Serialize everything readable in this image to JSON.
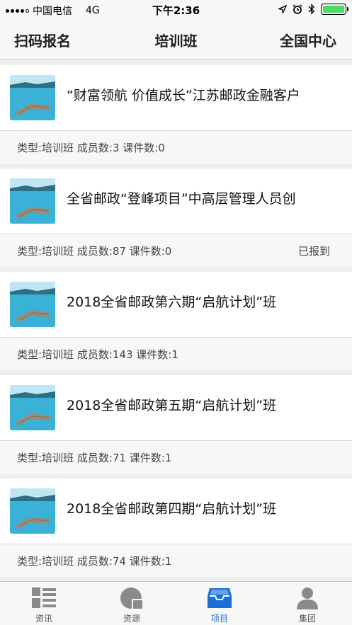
{
  "status_bar": {
    "carrier": "中国电信",
    "network": "4G",
    "time": "下午2:36"
  },
  "nav": {
    "left": "扫码报名",
    "title": "培训班",
    "right": "全国中心"
  },
  "projects": [
    {
      "title": "“财富领航 价值成长”江苏邮政金融客户",
      "meta": "类型:培训班 成员数:3 课件数:0",
      "status": ""
    },
    {
      "title": "全省邮政“登峰项目”中高层管理人员创",
      "meta": "类型:培训班 成员数:87 课件数:0",
      "status": "已报到"
    },
    {
      "title": "2018全省邮政第六期“启航计划”班",
      "meta": "类型:培训班 成员数:143 课件数:1",
      "status": ""
    },
    {
      "title": "2018全省邮政第五期“启航计划”班",
      "meta": "类型:培训班 成员数:71 课件数:1",
      "status": ""
    },
    {
      "title": "2018全省邮政第四期“启航计划”班",
      "meta": "类型:培训班 成员数:74 课件数:1",
      "status": ""
    }
  ],
  "tabs": [
    {
      "label": "资讯",
      "icon": "news-icon"
    },
    {
      "label": "资源",
      "icon": "resources-icon"
    },
    {
      "label": "项目",
      "icon": "projects-icon"
    },
    {
      "label": "集团",
      "icon": "group-icon"
    }
  ],
  "active_tab": "项目",
  "colors": {
    "accent": "#1a6fd6",
    "battery": "#4cd964",
    "inactive_icon": "#8a8a8a"
  }
}
